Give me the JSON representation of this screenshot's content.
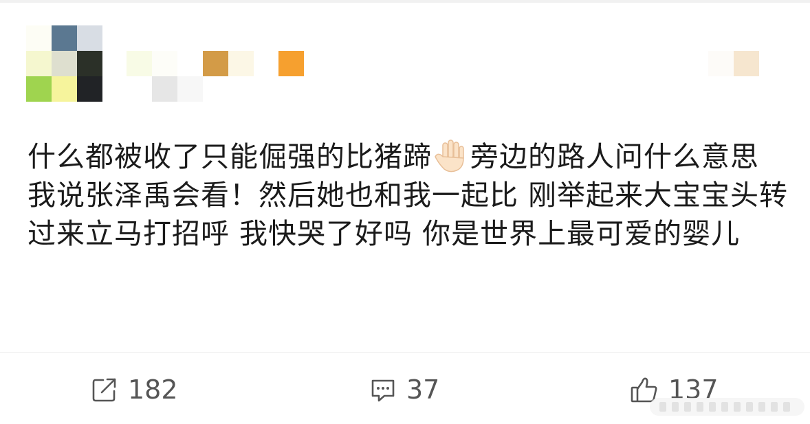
{
  "post": {
    "text_before_emoji": "什么都被收了只能倔强的比猪蹄",
    "emoji": "raised-hand",
    "text_after_emoji": "旁边的路人问什么意思 我说张泽禹会看！然后她也和我一起比 刚举起来大宝宝头转过来立马打招呼 我快哭了好吗 你是世界上最可爱的婴儿"
  },
  "actions": {
    "repost_count": "182",
    "comment_count": "37",
    "like_count": "137"
  },
  "icons": {
    "repost": "share-out-icon",
    "comment": "comment-bubble-icon",
    "like": "thumbs-up-icon"
  },
  "colors": {
    "text": "#1b1b1b",
    "action_text": "#555555",
    "divider": "#ececec"
  }
}
